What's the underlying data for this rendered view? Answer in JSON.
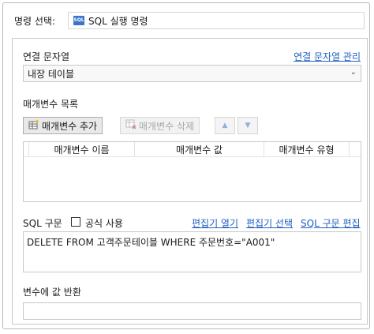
{
  "command": {
    "label": "명령 선택:",
    "icon_text": "SQL",
    "value": "SQL 실행 명령"
  },
  "connection": {
    "label": "연결 문자열",
    "manage_link": "연결 문자열 관리",
    "selected": "내장 테이블"
  },
  "params": {
    "label": "매개변수 목록",
    "add_button": "매개변수 추가",
    "delete_button": "매개변수 삭제",
    "columns": [
      "매개변수 이름",
      "매개변수 값",
      "매개변수 유형"
    ]
  },
  "sql": {
    "label": "SQL 구문",
    "formula_label": "공식 사용",
    "formula_checked": false,
    "editor_open_link": "편집기 열기",
    "editor_select_link": "편집기 선택",
    "sql_edit_link": "SQL 구문 편집",
    "text": "DELETE FROM 고객주문테이블 WHERE 주문번호=\"A001\""
  },
  "return_value": {
    "label": "변수에 값 반환",
    "value": ""
  },
  "colors": {
    "link": "#1f5fbf",
    "sql_icon": "#3b74c8",
    "border": "#c8c8c8"
  }
}
